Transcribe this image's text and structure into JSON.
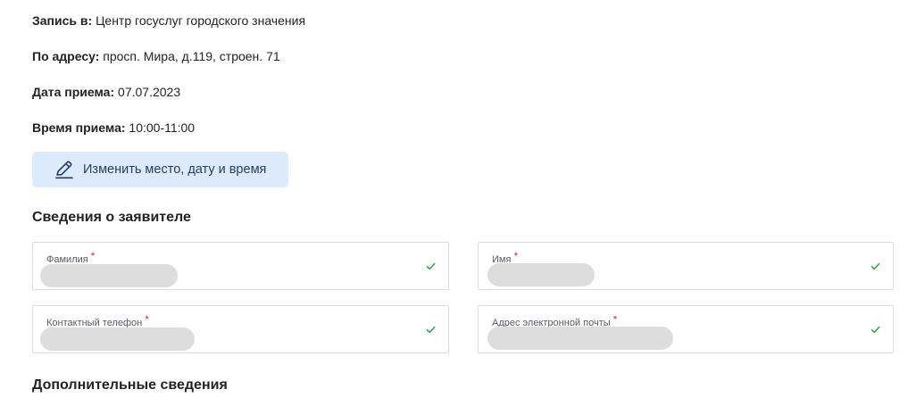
{
  "appointment": {
    "place_label": "Запись в:",
    "place_value": "Центр госуслуг городского значения",
    "address_label": "По адресу:",
    "address_value": "просп. Мира, д.119, строен. 71",
    "date_label": "Дата приема:",
    "date_value": "07.07.2023",
    "time_label": "Время приема:",
    "time_value": "10:00-11:00"
  },
  "change_button": {
    "label": "Изменить место, дату и время",
    "icon": "pen-icon",
    "background": "#ddeafc",
    "text_color": "#233f63"
  },
  "applicant_section": {
    "title": "Сведения о заявителе",
    "fields": [
      {
        "label": "Фамилия",
        "required_mark": "*",
        "status_icon": "check-icon"
      },
      {
        "label": "Имя",
        "required_mark": "*",
        "status_icon": "check-icon"
      },
      {
        "label": "Контактный телефон",
        "required_mark": "*",
        "status_icon": "check-icon"
      },
      {
        "label": "Адрес электронной почты",
        "required_mark": "*",
        "status_icon": "check-icon"
      }
    ]
  },
  "additional_section": {
    "title": "Дополнительные сведения"
  },
  "colors": {
    "required": "#e5283a",
    "valid_check": "#2e9e4d",
    "redacted_fill": "#dddddd"
  }
}
